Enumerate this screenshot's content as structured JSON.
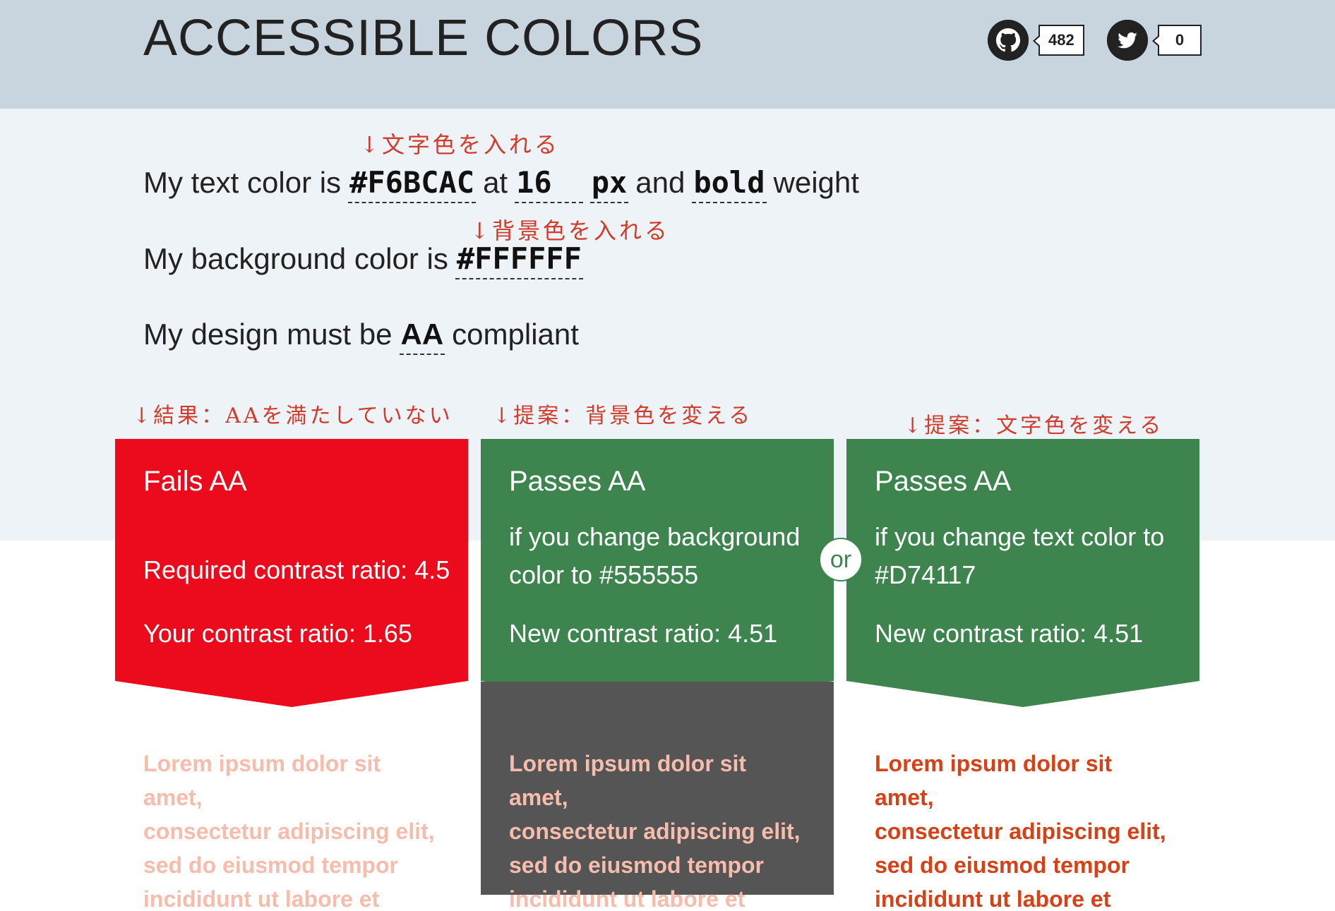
{
  "header": {
    "title": "ACCESSIBLE COLORS",
    "github": {
      "icon": "github-icon",
      "count": "482"
    },
    "twitter": {
      "icon": "twitter-icon",
      "count": "0"
    }
  },
  "form": {
    "line1": {
      "prefix": "My text color is",
      "text_color": "#F6BCAC",
      "at": "at",
      "size": "16",
      "unit": "px",
      "and": "and",
      "weight": "bold",
      "suffix": "weight"
    },
    "line2": {
      "prefix": "My background color is",
      "bg_color": "#FFFFFF"
    },
    "line3": {
      "prefix": "My design must be",
      "level": "AA",
      "suffix": "compliant"
    }
  },
  "annotations": {
    "text_color_note": "↓文字色を入れる",
    "bg_color_note": "↓背景色を入れる",
    "result_note": "↓結果：AAを満たしていない",
    "suggest_bg_note": "↓提案：背景色を変える",
    "suggest_text_note": "↓提案：文字色を変える"
  },
  "cards": {
    "fail": {
      "title": "Fails AA",
      "required": "Required contrast ratio: 4.5",
      "yours": "Your contrast ratio: 1.65",
      "color": "#EC0B1C"
    },
    "pass_bg": {
      "title": "Passes AA",
      "subtitle_1": "if you change background",
      "subtitle_2": "color to #555555",
      "ratio": "New contrast ratio: 4.51",
      "color": "#3D844E"
    },
    "or_label": "or",
    "pass_text": {
      "title": "Passes AA",
      "subtitle_1": "if you change text color to",
      "subtitle_2": "#D74117",
      "ratio": "New contrast ratio: 4.51",
      "color": "#3D844E"
    }
  },
  "previews": {
    "fail": {
      "lines": [
        "Lorem ipsum dolor sit amet,",
        "consectetur adipiscing elit,",
        "sed do eiusmod tempor",
        "incididunt ut labore et dolor…"
      ],
      "text_color": "#F6BCAC",
      "bg_color": "#FFFFFF"
    },
    "pass_bg": {
      "lines": [
        "Lorem ipsum dolor sit amet,",
        "consectetur adipiscing elit,",
        "sed do eiusmod tempor",
        "incididunt ut labore et dolor…"
      ],
      "text_color": "#F6BCAC",
      "bg_color": "#555555"
    },
    "pass_text": {
      "lines": [
        "Lorem ipsum dolor sit amet,",
        "consectetur adipiscing elit,",
        "sed do eiusmod tempor",
        "incididunt ut labore et dolor…"
      ],
      "text_color": "#D74117",
      "bg_color": "#FFFFFF"
    }
  }
}
